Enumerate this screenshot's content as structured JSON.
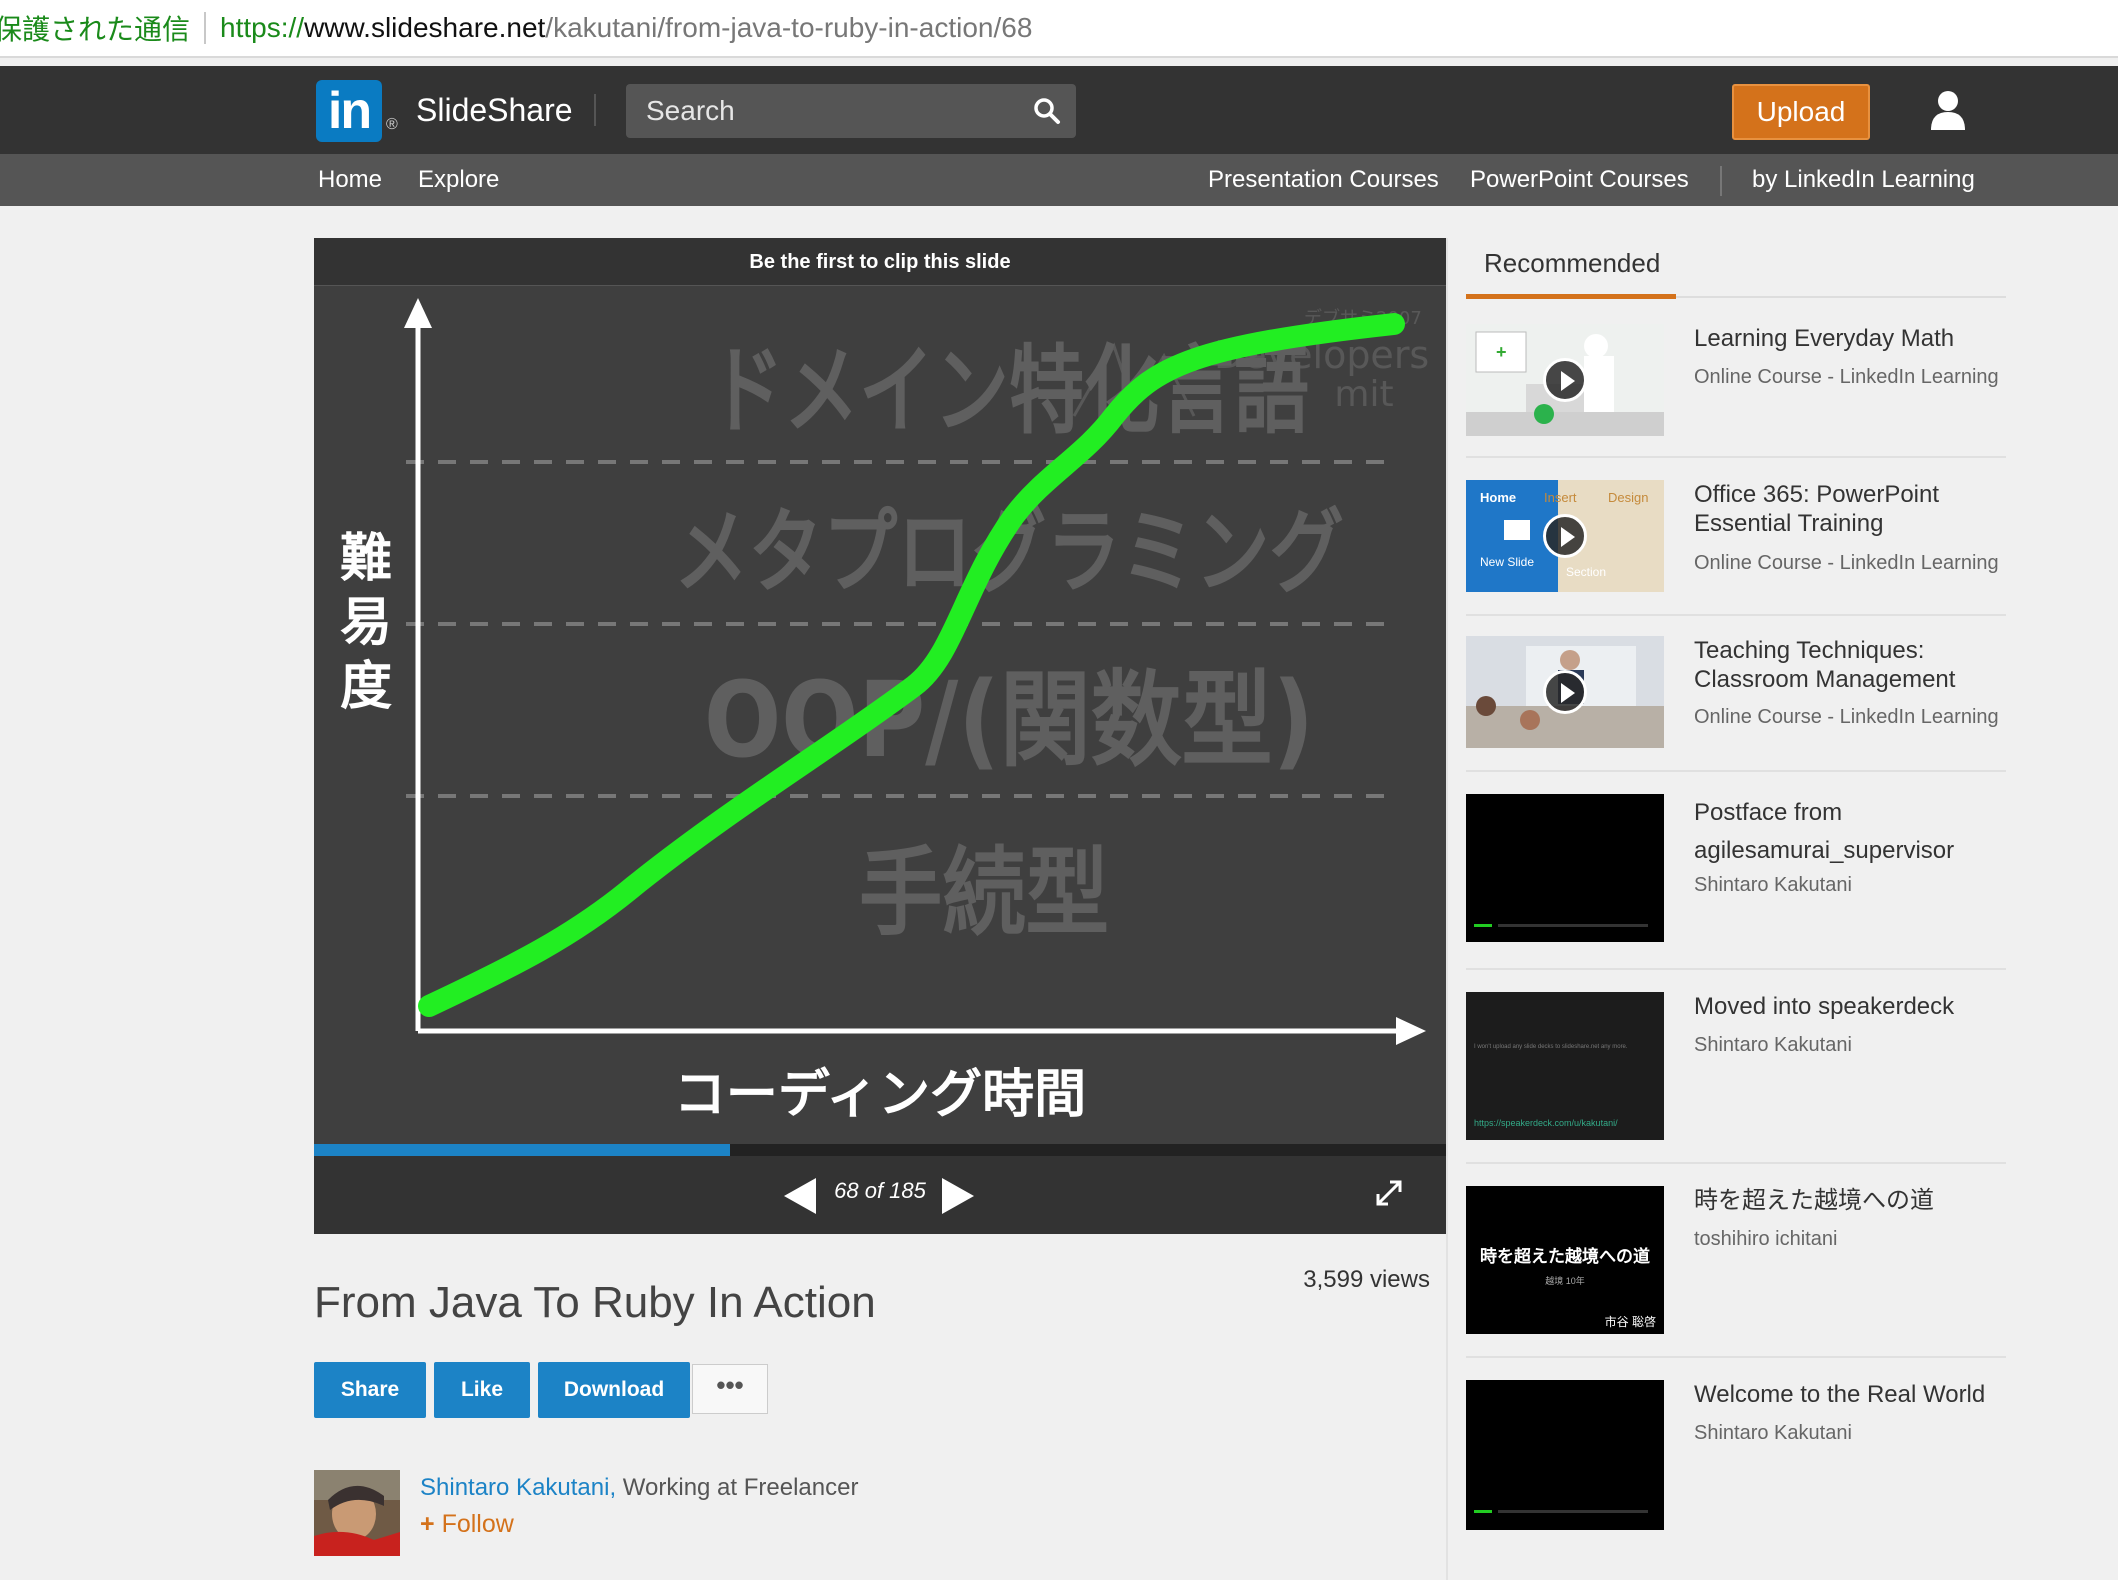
{
  "browser": {
    "secure_label": "保護された通信",
    "url_scheme": "https://",
    "url_host": "www.slideshare.net",
    "url_path": "/kakutani/from-java-to-ruby-in-action/68"
  },
  "header": {
    "logo_text": "in",
    "logo_reg": "®",
    "brand": "SlideShare",
    "search_placeholder": "Search",
    "upload_label": "Upload"
  },
  "subnav": {
    "home": "Home",
    "explore": "Explore",
    "presentation_courses": "Presentation Courses",
    "powerpoint_courses": "PowerPoint Courses",
    "by_linkedin": "by LinkedIn Learning"
  },
  "player": {
    "clip_text": "Be the first to clip this slide",
    "current_page": 68,
    "total_pages": 185,
    "page_label": "68 of 185",
    "progress_fraction": 0.3676,
    "slide": {
      "y_label": [
        "難",
        "易",
        "度"
      ],
      "x_label": "コーディング時間",
      "levels": [
        "ドメイン特化言語",
        "メタプログラミング",
        "OOP/(関数型)",
        "手続型"
      ],
      "watermark_title": "Developers",
      "watermark_sub": "mit",
      "watermark_small": "デブサミ2007",
      "curve_color": "#22ee22"
    }
  },
  "presentation": {
    "views": "3,599 views",
    "title": "From Java To Ruby In Action",
    "share": "Share",
    "like": "Like",
    "download": "Download",
    "more": "•••",
    "author_name": "Shintaro Kakutani,",
    "author_job": "Working at Freelancer",
    "follow": "Follow",
    "follow_icon": "+"
  },
  "sidebar": {
    "heading": "Recommended",
    "items": [
      {
        "title": "Learning Everyday Math",
        "subtitle": "Online Course - LinkedIn Learning"
      },
      {
        "title": "Office 365: PowerPoint Essential Training",
        "subtitle": "Online Course - LinkedIn Learning"
      },
      {
        "title": "Teaching Techniques: Classroom Management",
        "subtitle": "Online Course - LinkedIn Learning"
      },
      {
        "title": "Postface from agilesamurai_supervisor",
        "subtitle": "Shintaro Kakutani"
      },
      {
        "title": "Moved into speakerdeck",
        "subtitle": "Shintaro Kakutani"
      },
      {
        "title": "時を超えた越境への道",
        "subtitle": "toshihiro ichitani"
      },
      {
        "title": "Welcome to the Real World",
        "subtitle": "Shintaro Kakutani"
      }
    ],
    "thumb_texts": {
      "office_home": "Home",
      "office_insert": "Insert",
      "office_design": "Design",
      "office_new_slide": "New Slide",
      "office_section": "Section",
      "speakerdeck_line1": "I won't upload any slide decks to slideshare.net any more.",
      "speakerdeck_url": "https://speakerdeck.com/u/kakutani/",
      "toki_title": "時を超えた越境への道",
      "toki_sub": "越境 10年",
      "toki_author": "市谷 聡啓"
    }
  }
}
